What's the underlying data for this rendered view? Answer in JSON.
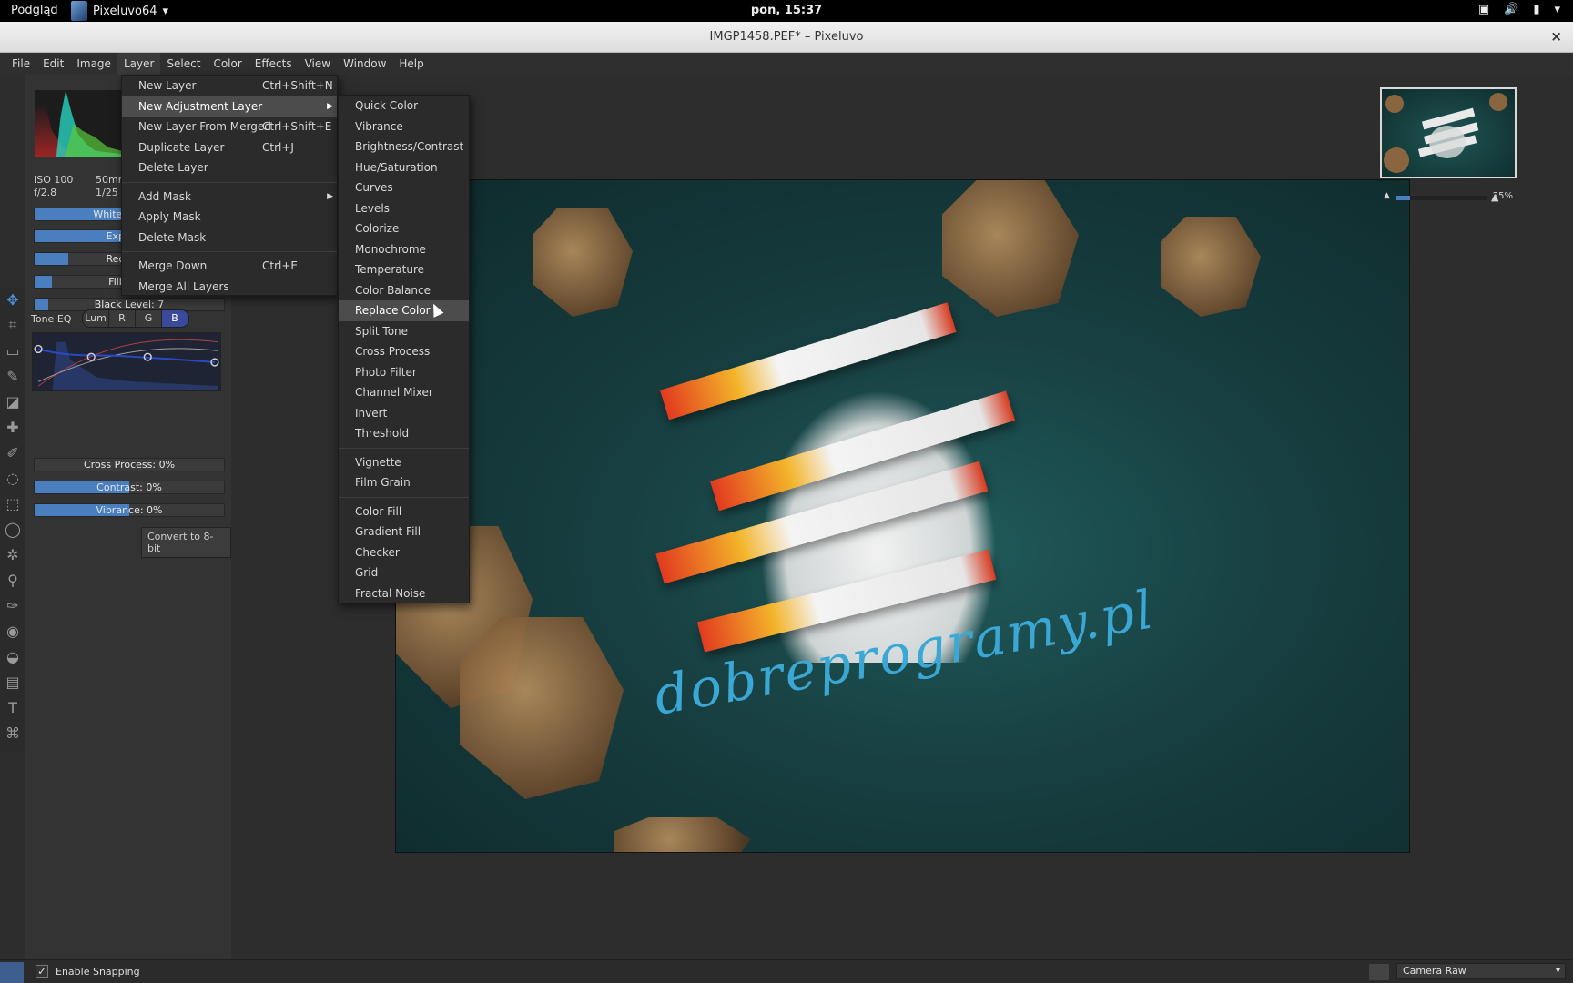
{
  "topbar": {
    "activities": "Podgląd",
    "app_name": "Pixeluvo64",
    "clock": "pon, 15:37"
  },
  "window": {
    "title": "IMGP1458.PEF* – Pixeluvo"
  },
  "menubar": [
    "File",
    "Edit",
    "Image",
    "Layer",
    "Select",
    "Color",
    "Effects",
    "View",
    "Window",
    "Help"
  ],
  "layer_menu": {
    "group1": [
      {
        "label": "New Layer",
        "accel": "Ctrl+Shift+N"
      },
      {
        "label": "New Adjustment Layer",
        "accel": "",
        "submenu": true
      },
      {
        "label": "New Layer From Merged",
        "accel": "Ctrl+Shift+E"
      },
      {
        "label": "Duplicate Layer",
        "accel": "Ctrl+J"
      },
      {
        "label": "Delete Layer",
        "accel": ""
      }
    ],
    "group2": [
      {
        "label": "Add Mask",
        "accel": "",
        "submenu": true
      },
      {
        "label": "Apply Mask",
        "accel": ""
      },
      {
        "label": "Delete Mask",
        "accel": ""
      }
    ],
    "group3": [
      {
        "label": "Merge Down",
        "accel": "Ctrl+E"
      },
      {
        "label": "Merge All Layers",
        "accel": ""
      }
    ]
  },
  "adjustment_menu": {
    "group1": [
      "Quick Color",
      "Vibrance",
      "Brightness/Contrast",
      "Hue/Saturation",
      "Curves",
      "Levels",
      "Colorize",
      "Monochrome",
      "Temperature",
      "Color Balance",
      "Replace Color",
      "Split Tone",
      "Cross Process",
      "Photo Filter",
      "Channel Mixer",
      "Invert",
      "Threshold"
    ],
    "group2": [
      "Vignette",
      "Film Grain"
    ],
    "group3": [
      "Color Fill",
      "Gradient Fill",
      "Checker",
      "Grid",
      "Fractal Noise"
    ],
    "highlighted": "Replace Color"
  },
  "panel": {
    "exif": {
      "iso": "ISO 100",
      "focal": "50mm",
      "aperture": "f/2.8",
      "shutter": "1/25 s"
    },
    "sliders": [
      {
        "label": "White Balance",
        "fill": 0.55
      },
      {
        "label": "Exposure",
        "fill": 0.55
      },
      {
        "label": "Recovery",
        "fill": 0.18
      },
      {
        "label": "Fill Light",
        "fill": 0.09
      },
      {
        "label": "Black Level: 7",
        "fill": 0.07
      }
    ],
    "tone_eq": {
      "label": "Tone EQ",
      "buttons": [
        "Lum",
        "R",
        "G",
        "B"
      ],
      "active": "B"
    },
    "sliders2": [
      {
        "label": "Cross Process: 0%",
        "fill": 0.0
      },
      {
        "label": "Contrast: 0%",
        "fill": 0.5
      },
      {
        "label": "Vibrance: 0%",
        "fill": 0.5
      }
    ],
    "convert_button": "Convert to 8-bit"
  },
  "canvas": {
    "signature": "dobreprogramy.pl"
  },
  "navigator": {
    "zoom": "25%"
  },
  "statusbar": {
    "snapping_label": "Enable Snapping",
    "snapping_checked": true,
    "preset": "Camera Raw"
  }
}
